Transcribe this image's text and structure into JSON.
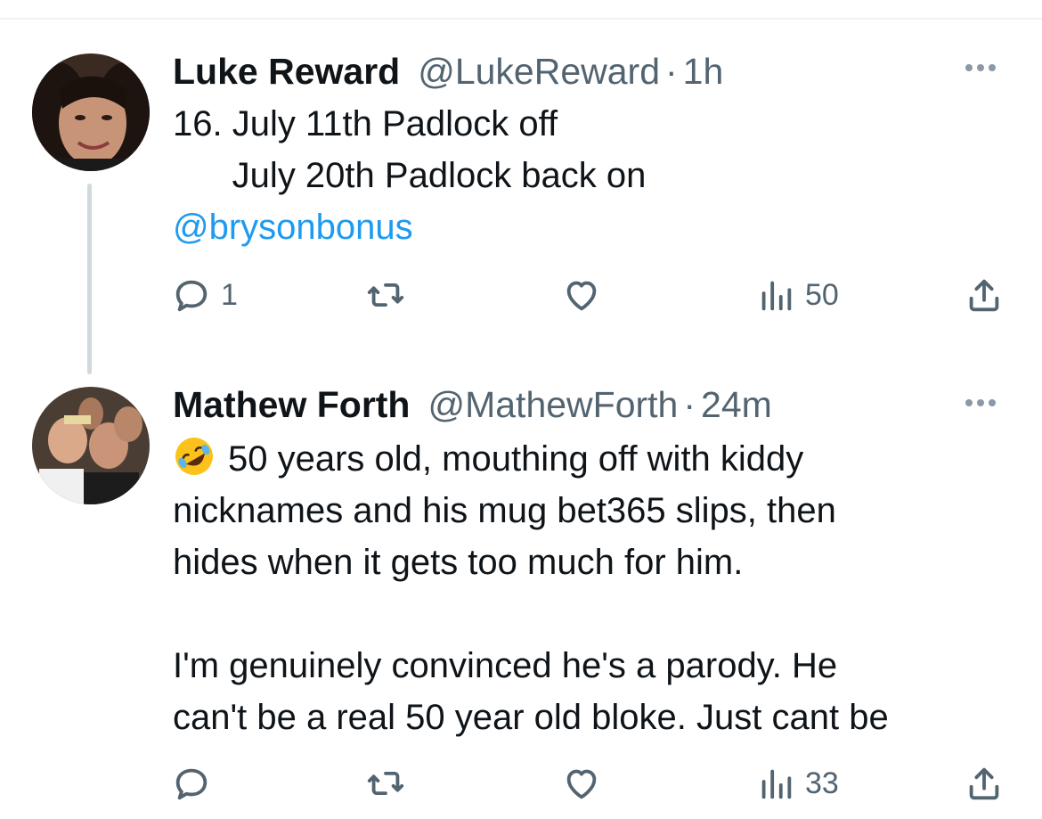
{
  "tweets": [
    {
      "name": "Luke Reward",
      "handle": "@LukeReward",
      "separator": "·",
      "time": "1h",
      "text_lines": [
        "16. July 11th Padlock off",
        "      July 20th Padlock back on"
      ],
      "mention": "@brysonbonus",
      "stats": {
        "replies": "1",
        "retweets": "",
        "likes": "",
        "views": "50"
      }
    },
    {
      "name": "Mathew Forth",
      "handle": "@MathewForth",
      "separator": "·",
      "time": "24m",
      "emoji": "rolling-on-floor-laughing-emoji",
      "text_lines": [
        "50 years old, mouthing off with kiddy",
        "nicknames and his mug bet365 slips, then",
        "hides when it gets too much for him.",
        "",
        "I'm genuinely convinced he's a parody. He",
        "can't be a real 50 year old bloke. Just cant be"
      ],
      "stats": {
        "replies": "",
        "retweets": "",
        "likes": "",
        "views": "33"
      }
    }
  ],
  "icons": [
    "reply-icon",
    "retweet-icon",
    "like-icon",
    "views-icon",
    "share-icon",
    "more-options-icon"
  ],
  "colors": {
    "text": "#0f1419",
    "secondary": "#536471",
    "link": "#1d9bf0",
    "thread_line": "#cfd9de"
  }
}
